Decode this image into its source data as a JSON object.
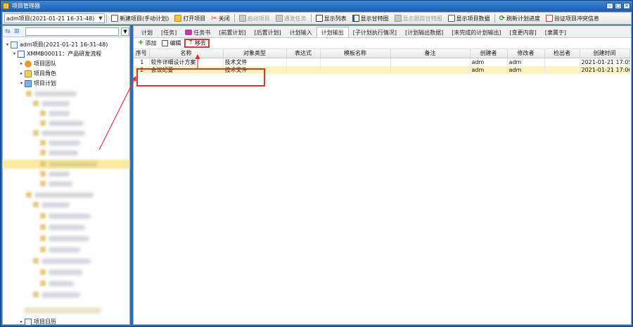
{
  "window": {
    "title": "项目管理器"
  },
  "toolbar": {
    "project_select": "adm项目(2021-01-21  16-31-48)",
    "buttons": [
      {
        "label": "新建项目(手动计划)",
        "icon": "document-icon",
        "disabled": false
      },
      {
        "label": "打开项目",
        "icon": "folder-icon",
        "disabled": false
      },
      {
        "label": "关闭",
        "icon": "close-icon",
        "disabled": false
      },
      {
        "label": "启动项目",
        "icon": "start-icon",
        "disabled": true
      },
      {
        "label": "通发任务",
        "icon": "send-icon",
        "disabled": true
      },
      {
        "label": "显示列表",
        "icon": "list-icon",
        "disabled": false
      },
      {
        "label": "显示甘特图",
        "icon": "gantt-icon",
        "disabled": false
      },
      {
        "label": "显示跟踪甘特图",
        "icon": "tracking-gantt-icon",
        "disabled": true
      },
      {
        "label": "显示项目数据",
        "icon": "data-icon",
        "disabled": false
      },
      {
        "label": "刷新计划进度",
        "icon": "refresh-icon",
        "disabled": false
      },
      {
        "label": "验证项目冲突信息",
        "icon": "verify-icon",
        "disabled": false
      }
    ]
  },
  "tree": {
    "root": "adm项目(2021-01-21  16-31-48)",
    "flow": "XMMB00011：产品研发流程",
    "team": "项目团队",
    "role": "项目角色",
    "plan": "项目计划",
    "calendar": "项目日历"
  },
  "tabs": [
    {
      "label": "计划",
      "active": false,
      "icon": false
    },
    {
      "label": "[任务]",
      "active": false,
      "icon": false
    },
    {
      "label": "任务书",
      "active": false,
      "icon": true
    },
    {
      "label": "[前置计划]",
      "active": false,
      "icon": false
    },
    {
      "label": "[后置计划]",
      "active": false,
      "icon": false
    },
    {
      "label": "计划输入",
      "active": false,
      "icon": false
    },
    {
      "label": "计划输出",
      "active": true,
      "icon": false
    },
    {
      "label": "[子计划执行情况]",
      "active": false,
      "icon": false
    },
    {
      "label": "[计划输出数据]",
      "active": false,
      "icon": false
    },
    {
      "label": "[未完成的计划输出]",
      "active": false,
      "icon": false
    },
    {
      "label": "[变更内容]",
      "active": false,
      "icon": false
    },
    {
      "label": "[隶属于]",
      "active": false,
      "icon": false
    }
  ],
  "actions": {
    "add": "添加",
    "edit": "编辑",
    "remove": "移去"
  },
  "table": {
    "columns": [
      "序号",
      "名称",
      "对象类型",
      "表达式",
      "模板名称",
      "备注",
      "创建者",
      "修改者",
      "检出者",
      "创建时间"
    ],
    "rows": [
      {
        "num": "1",
        "name": "软件详细设计方案",
        "type": "技术文件",
        "expr": "",
        "template": "",
        "note": "",
        "creator": "adm",
        "modifier": "adm",
        "checkout": "",
        "time": "2021-01-21 17:05",
        "selected": false
      },
      {
        "num": "2",
        "name": "会议纪要",
        "type": "技术文件",
        "expr": "",
        "template": "",
        "note": "",
        "creator": "adm",
        "modifier": "adm",
        "checkout": "",
        "time": "2021-01-21 17:06",
        "selected": true
      }
    ]
  },
  "colors": {
    "titlebar": "#1f5fae",
    "highlight_red": "#e23333",
    "row_selected": "#fdf3c0"
  }
}
